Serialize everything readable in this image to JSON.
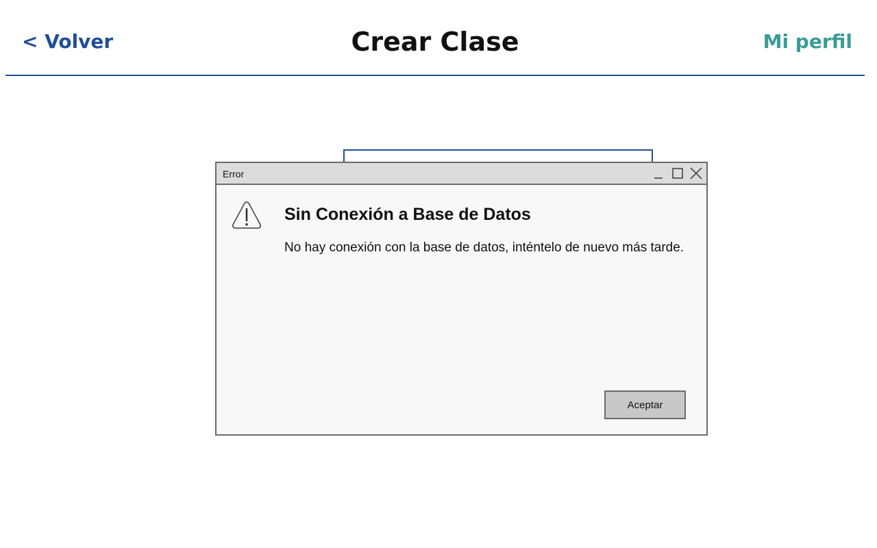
{
  "header": {
    "back_label": "< Volver",
    "title": "Crear Clase",
    "profile_label": "Mi perfil"
  },
  "dialog": {
    "window_title": "Error",
    "heading": "Sin Conexión a Base de Datos",
    "message": "No hay conexión con la base de datos, inténtelo de nuevo más tarde.",
    "accept_label": "Aceptar",
    "icons": [
      "warning-icon",
      "minimize-icon",
      "maximize-icon",
      "close-icon"
    ]
  },
  "colors": {
    "primary_blue": "#1f4f96",
    "accent_teal": "#3a9c97",
    "dialog_border": "#6b6b6b",
    "titlebar_bg": "#dcdcdc",
    "button_bg": "#c8c8c8"
  }
}
